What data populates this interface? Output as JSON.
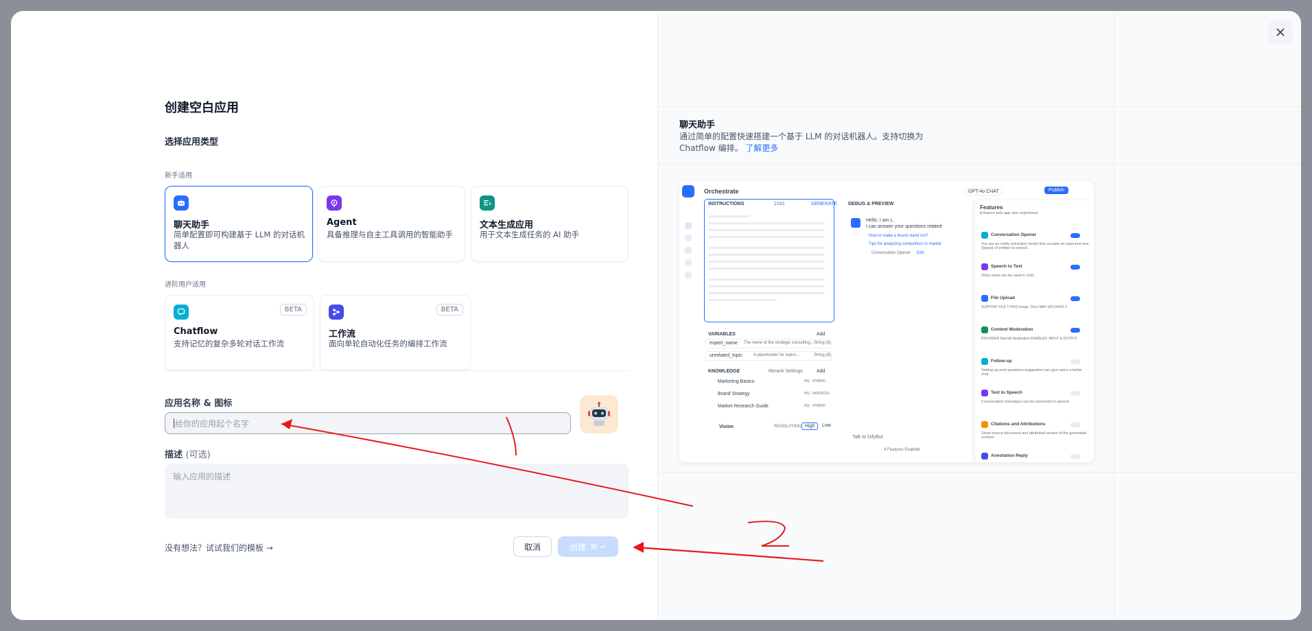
{
  "modal": {
    "title": "创建空白应用",
    "type_heading": "选择应用类型",
    "beginner_label": "新手适用",
    "advanced_label": "进阶用户适用",
    "cards_beginner": [
      {
        "title": "聊天助手",
        "desc": "简单配置即可构建基于 LLM 的对话机器人",
        "color": "#296dff",
        "icon": "chat-bot-icon"
      },
      {
        "title": "Agent",
        "desc": "具备推理与自主工具调用的智能助手",
        "color": "#7839ee",
        "icon": "agent-icon"
      },
      {
        "title": "文本生成应用",
        "desc": "用于文本生成任务的 AI 助手",
        "color": "#0e9384",
        "icon": "text-gen-icon"
      }
    ],
    "cards_advanced": [
      {
        "title": "Chatflow",
        "desc": "支持记忆的复杂多轮对话工作流",
        "badge": "BETA",
        "color": "#06aed4",
        "icon": "chatflow-icon"
      },
      {
        "title": "工作流",
        "desc": "面向单轮自动化任务的编排工作流",
        "badge": "BETA",
        "color": "#444ce7",
        "icon": "workflow-icon"
      }
    ],
    "name_label": "应用名称 & 图标",
    "name_placeholder": "给你的应用起个名字",
    "desc_label": "描述",
    "desc_optional": "(可选)",
    "desc_placeholder": "输入应用的描述",
    "template_link": "没有想法？试试我们的模板",
    "cancel": "取消",
    "create": "创建",
    "create_shortcut": "⌘ ↵"
  },
  "preview": {
    "title": "聊天助手",
    "desc": "通过简单的配置快速搭建一个基于 LLM 的对话机器人。支持切换为 Chatflow 编排。",
    "learn_more": "了解更多",
    "orchestrate": "Orchestrate",
    "model": "GPT-4o",
    "model_tag": "CHAT",
    "publish": "Publish",
    "instructions": "INSTRUCTIONS",
    "instr_count": "2162",
    "generate": "GENERATE",
    "debug": "DEBUG & PREVIEW",
    "hello": "Hello, I am L.",
    "hello2": "I can answer your questions related",
    "suggestion1": "How to make a brand stand out?",
    "suggestion2": "Tips for analyzing competitors in market",
    "conv_opener": "Conversation Opener",
    "edit": "Edit",
    "variables": "VARIABLES",
    "add": "Add",
    "vars": [
      {
        "name": "expert_name",
        "desc": "The name of the strategic consulting...",
        "type": "String (8)"
      },
      {
        "name": "unrelated_topic",
        "desc": "A placeholder for topics...",
        "req": "REQUIRED",
        "type": "String (8)"
      }
    ],
    "knowledge": "KNOWLEDGE",
    "rerank": "Rerank Settings",
    "docs": [
      {
        "name": "Marketing Basics",
        "tag": "HQ · HYBRID"
      },
      {
        "name": "Brand Strategy",
        "tag": "HQ · INVERTED"
      },
      {
        "name": "Market Research Guide",
        "tag": "HQ · HYBRID"
      }
    ],
    "vision": "Vision",
    "resolution": "RESOLUTION",
    "high": "High",
    "low": "Low",
    "talk": "Talk to DifyBot",
    "features_enabled": "4 Features Enabled",
    "features_title": "Features",
    "features_sub": "Enhance web app user experience",
    "features": [
      {
        "name": "Conversation Opener",
        "desc": "You are an entity extraction model that accepts an input text and {{type}} of entities to extract.",
        "on": true,
        "color": "#06aed4"
      },
      {
        "name": "Speech to Text",
        "desc": "Voice input can be used in chat.",
        "on": true,
        "color": "#7839ee"
      },
      {
        "name": "File Upload",
        "desc": "SUPPORT FILE TYPES  Image, Docs   MAX UPLOADS 3",
        "on": true,
        "color": "#296dff"
      },
      {
        "name": "Content Moderation",
        "desc": "PROVIDER OpenAI Moderation   ENABLED: INPUT & OUTPUT",
        "on": true,
        "color": "#079455"
      },
      {
        "name": "Follow-up",
        "desc": "Setting up next questions suggestion can give users a better chat.",
        "on": false,
        "color": "#06aed4"
      },
      {
        "name": "Text to Speech",
        "desc": "Conversation messages can be converted to speech.",
        "on": false,
        "color": "#7839ee"
      },
      {
        "name": "Citations and Attributions",
        "desc": "Show source document and attributed section of the generated content.",
        "on": false,
        "color": "#f79009"
      },
      {
        "name": "Annotation Reply",
        "desc": "",
        "on": false,
        "color": "#444ce7"
      }
    ]
  },
  "annotations": {
    "mark_1": "1",
    "mark_2": "2"
  },
  "colors": {
    "accent": "#296dff",
    "annotation_red": "#e8191b"
  }
}
